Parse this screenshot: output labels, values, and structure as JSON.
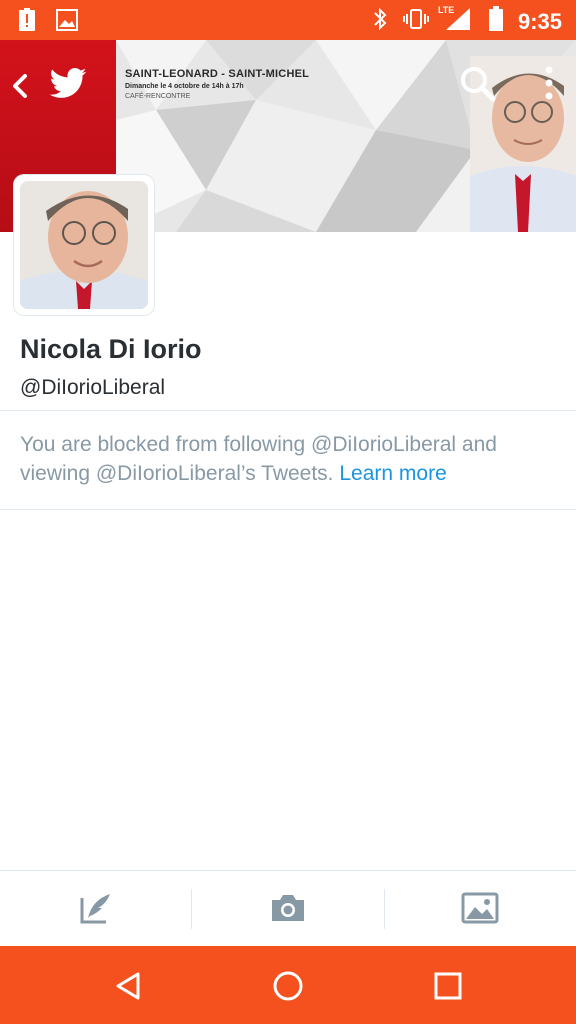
{
  "status_bar": {
    "time": "9:35",
    "network": "LTE",
    "icons": [
      "alert-icon",
      "image-icon",
      "bluetooth-icon",
      "vibrate-icon",
      "signal-icon",
      "battery-icon"
    ]
  },
  "header": {
    "banner_title": "SAINT-LEONARD - SAINT-MICHEL",
    "banner_subtitle": "Dimanche le 4 octobre de 14h à 17h",
    "banner_event": "CAFÉ-RENCONTRE",
    "icons": [
      "back-icon",
      "twitter-bird-icon",
      "search-icon",
      "more-vert-icon"
    ]
  },
  "profile": {
    "name": "Nicola Di Iorio",
    "handle": "@DiIorioLiberal"
  },
  "blocked_notice": {
    "text": "You are blocked from following @DiIorioLiberal and viewing @DiIorioLiberal’s Tweets.",
    "link": "Learn more"
  },
  "compose_bar": {
    "items": [
      "compose-tweet-icon",
      "camera-icon",
      "gallery-icon"
    ]
  },
  "nav_bar": {
    "items": [
      "back-triangle-icon",
      "home-circle-icon",
      "recents-square-icon"
    ]
  },
  "colors": {
    "status_bar": "#f4511e",
    "banner_red": "#d3121b",
    "link": "#1b95e0",
    "muted_text": "#8899a6",
    "primary_text": "#292f33"
  }
}
